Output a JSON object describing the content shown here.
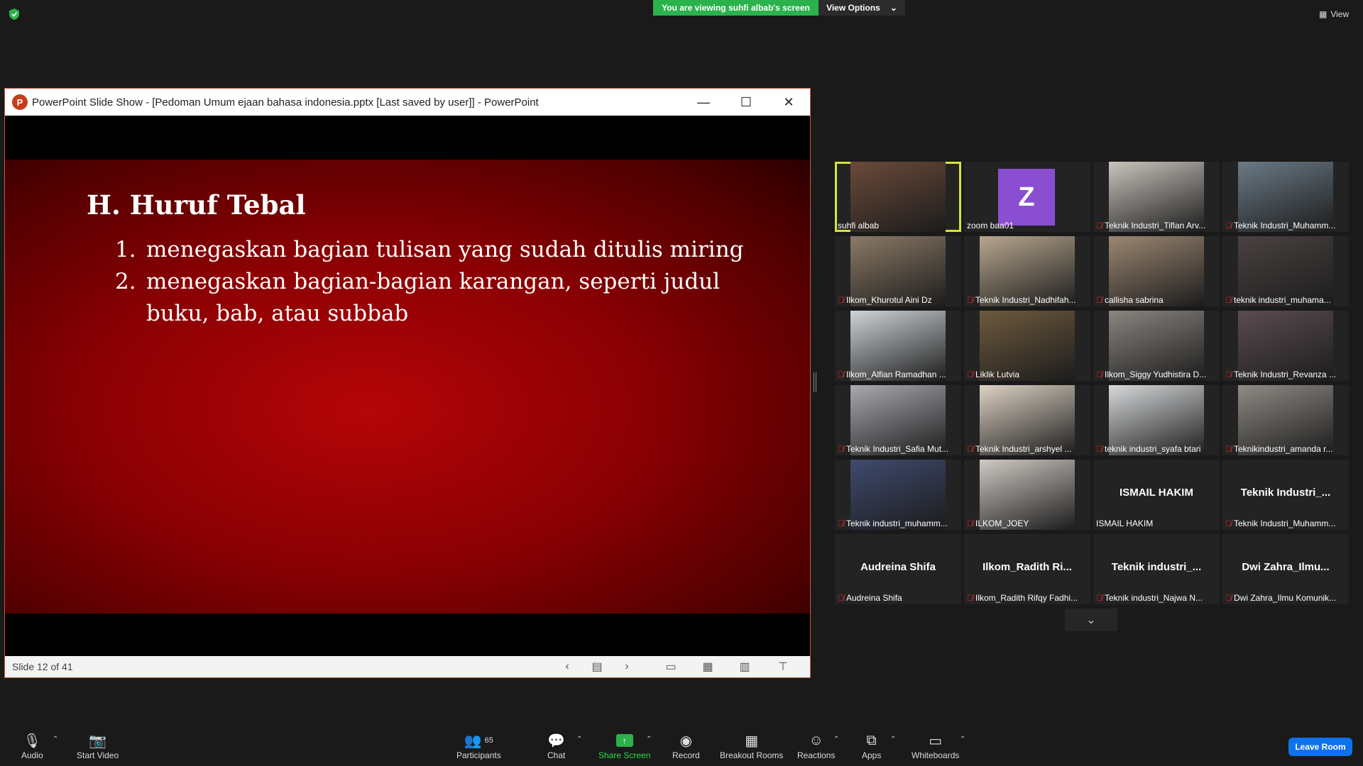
{
  "top_bar": {
    "viewing_banner": "You are viewing suhfi albab's screen",
    "view_options": "View Options",
    "view": "View"
  },
  "ppt": {
    "window_title": "PowerPoint Slide Show - [Pedoman Umum ejaan bahasa indonesia.pptx [Last saved by user]] - PowerPoint",
    "logo_letter": "P",
    "slide": {
      "heading": "H. Huruf Tebal",
      "items": [
        {
          "num": "1.",
          "text": "menegaskan bagian tulisan yang sudah ditulis miring"
        },
        {
          "num": "2.",
          "text": "menegaskan bagian-bagian karangan, seperti judul buku, bab, atau subbab"
        }
      ]
    },
    "status": "Slide 12 of 41"
  },
  "participants": [
    {
      "name": "suhfi albab",
      "muted": false,
      "active": true,
      "bg": "#6b4a3a"
    },
    {
      "name": "zoom baa01",
      "muted": false,
      "avatar": "Z"
    },
    {
      "name": "Teknik Industri_Tiflan Arv...",
      "muted": true,
      "bg": "#c9c4bd"
    },
    {
      "name": "Teknik Industri_Muhamm...",
      "muted": true,
      "bg": "#6b7a86"
    },
    {
      "name": "Ilkom_Khurotul Aini Dz",
      "muted": true,
      "bg": "#8b7a66"
    },
    {
      "name": "Teknik Industri_Nadhifah...",
      "muted": true,
      "bg": "#b8a78f"
    },
    {
      "name": "callisha sabrina",
      "muted": true,
      "bg": "#9c8772"
    },
    {
      "name": "teknik industri_muhama...",
      "muted": true,
      "bg": "#4a4242"
    },
    {
      "name": "Ilkom_Alfian Ramadhan ...",
      "muted": true,
      "bg": "#cfd4d8"
    },
    {
      "name": "Liklik Lutvia",
      "muted": true,
      "bg": "#6e5a3e"
    },
    {
      "name": "Ilkom_Siggy Yudhistira D...",
      "muted": true,
      "bg": "#8a8580"
    },
    {
      "name": "Teknik Industri_Revanza ...",
      "muted": true,
      "bg": "#5a4c52"
    },
    {
      "name": "Teknik Industri_Safia Mut...",
      "muted": true,
      "bg": "#a9aab0"
    },
    {
      "name": "Teknik Industri_arshyel ...",
      "muted": true,
      "bg": "#ddd2c4"
    },
    {
      "name": "teknik industri_syafa btari",
      "muted": true,
      "bg": "#d7d9db"
    },
    {
      "name": "Teknikindustri_amanda r...",
      "muted": true,
      "bg": "#8f8b85"
    },
    {
      "name": "Teknik industri_muhamm...",
      "muted": true,
      "bg": "#3f4a6e"
    },
    {
      "name": "ILKOM_JOEY",
      "muted": true,
      "bg": "#cfcac4"
    },
    {
      "name": "ISMAIL HAKIM",
      "muted": false,
      "big": "ISMAIL HAKIM"
    },
    {
      "name": "Teknik Industri_Muhamm...",
      "muted": true,
      "big": "Teknik  Industri_..."
    },
    {
      "name": "Audreina Shifa",
      "muted": true,
      "big": "Audreina Shifa"
    },
    {
      "name": "Ilkom_Radith Rifqy Fadhi...",
      "muted": true,
      "big": "Ilkom_Radith  Ri..."
    },
    {
      "name": "Teknik industri_Najwa N...",
      "muted": true,
      "big": "Teknik  industri_..."
    },
    {
      "name": "Dwi Zahra_Ilmu Komunik...",
      "muted": true,
      "big": "Dwi  Zahra_Ilmu..."
    }
  ],
  "toolbar": {
    "audio": "Audio",
    "start_video": "Start Video",
    "participants": "Participants",
    "participants_count": "65",
    "chat": "Chat",
    "share_screen": "Share Screen",
    "record": "Record",
    "breakout_rooms": "Breakout Rooms",
    "reactions": "Reactions",
    "apps": "Apps",
    "whiteboards": "Whiteboards",
    "leave_room": "Leave Room"
  }
}
